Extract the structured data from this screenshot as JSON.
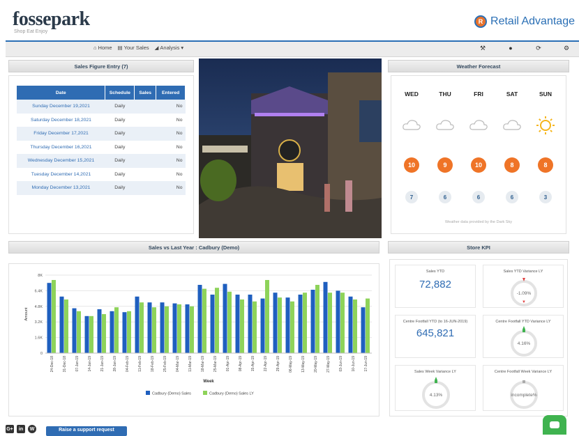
{
  "brand": {
    "name": "fossepark",
    "subtitle": "Shop Eat Enjoy",
    "partner": "Retail Advantage",
    "partner_mark": "R"
  },
  "nav": {
    "items": [
      {
        "icon": "home-icon",
        "label": "Home"
      },
      {
        "icon": "bar-chart-icon",
        "label": "Your Sales"
      },
      {
        "icon": "analysis-icon",
        "label": "Analysis"
      }
    ],
    "right_icons": [
      "wrench-icon",
      "help-icon",
      "refresh-icon",
      "gear-icon",
      "power-icon"
    ]
  },
  "sales_entry": {
    "title": "Sales Figure Entry (7)",
    "columns": [
      "Date",
      "Schedule",
      "Sales",
      "Entered"
    ],
    "rows": [
      {
        "date": "Sunday December 19,2021",
        "schedule": "Daily",
        "sales": "",
        "entered": "No"
      },
      {
        "date": "Saturday December 18,2021",
        "schedule": "Daily",
        "sales": "",
        "entered": "No"
      },
      {
        "date": "Friday December 17,2021",
        "schedule": "Daily",
        "sales": "",
        "entered": "No"
      },
      {
        "date": "Thursday December 16,2021",
        "schedule": "Daily",
        "sales": "",
        "entered": "No"
      },
      {
        "date": "Wednesday December 15,2021",
        "schedule": "Daily",
        "sales": "",
        "entered": "No"
      },
      {
        "date": "Tuesday December 14,2021",
        "schedule": "Daily",
        "sales": "",
        "entered": "No"
      },
      {
        "date": "Monday December 13,2021",
        "schedule": "Daily",
        "sales": "",
        "entered": "No"
      }
    ]
  },
  "weather": {
    "title": "Weather Forecast",
    "days": [
      "WED",
      "THU",
      "FRI",
      "SAT",
      "SUN"
    ],
    "icons": [
      "cloud-icon",
      "cloud-icon",
      "cloud-icon",
      "cloud-icon",
      "sun-icon"
    ],
    "highs": [
      "10",
      "9",
      "10",
      "8",
      "8"
    ],
    "lows": [
      "7",
      "6",
      "6",
      "6",
      "3"
    ],
    "note": "Weather data provided by the Dark Sky",
    "colors": {
      "high": "#ef7427",
      "low_bg": "#e6ebf0",
      "sun": "#f5b51c"
    }
  },
  "sales_chart": {
    "title": "Sales vs Last Year : Cadbury (Demo)"
  },
  "kpi": {
    "title": "Store KPI",
    "cards": [
      {
        "label": "Sales YTD",
        "value": "72,882"
      },
      {
        "label": "Sales YTD Variance LY",
        "value": "-1.09%",
        "gauge_color": "#e04040"
      },
      {
        "label": "Centre Footfall YTD (to 16-JUN-2019)",
        "value": "645,821"
      },
      {
        "label": "Centre Footfall YTD Variance LY",
        "value": "4.16%",
        "gauge_color": "#3fb34f"
      },
      {
        "label": "Sales Week Variance LY",
        "value": "4.13%",
        "gauge_color": "#3fb34f"
      },
      {
        "label": "Centre Footfall Week Variance LY",
        "value": "incomplete%",
        "gauge_color": "#aaaaaa"
      }
    ]
  },
  "footer": {
    "support_label": "Raise a support request",
    "social": [
      "google-plus-icon",
      "linkedin-icon",
      "wordpress-icon"
    ],
    "chat_icon": "chat-icon"
  },
  "chart_data": {
    "type": "bar",
    "title": "",
    "xlabel": "Week",
    "ylabel": "Amount",
    "ylim": [
      0,
      8000
    ],
    "yticks": [
      "0",
      "1.6K",
      "3.2K",
      "4.8K",
      "6.4K",
      "8K"
    ],
    "categories": [
      "24-Dec-18",
      "31-Dec-18",
      "07-Jan-19",
      "14-Jan-19",
      "21-Jan-19",
      "28-Jan-19",
      "04-Feb-19",
      "11-Feb-19",
      "18-Feb-19",
      "25-Feb-19",
      "04-Mar-19",
      "11-Mar-19",
      "18-Mar-19",
      "25-Mar-19",
      "01-Apr-19",
      "08-Apr-19",
      "15-Apr-19",
      "22-Apr-19",
      "29-Apr-19",
      "06-May-19",
      "13-May-19",
      "20-May-19",
      "27-May-19",
      "03-Jun-19",
      "10-Jun-19",
      "17-Jun-19"
    ],
    "series": [
      {
        "name": "Cadbury (Demo) Sales",
        "color": "#1f5fbf",
        "values": [
          7200,
          5800,
          4600,
          3800,
          4500,
          4300,
          4200,
          5800,
          5200,
          5200,
          5100,
          5000,
          7000,
          6000,
          7100,
          6000,
          6000,
          5600,
          6200,
          5700,
          6000,
          6500,
          7300,
          6400,
          5800,
          4700
        ]
      },
      {
        "name": "Cadbury (Demo) Sales LY",
        "color": "#8ed35a",
        "values": [
          7500,
          5500,
          4300,
          3800,
          4000,
          4700,
          4300,
          5200,
          4700,
          4800,
          5000,
          4800,
          6600,
          6700,
          6300,
          5500,
          5300,
          7500,
          5700,
          5300,
          6200,
          7000,
          6200,
          6200,
          5500,
          5600
        ]
      }
    ],
    "legend": "bottom",
    "grid": true
  }
}
